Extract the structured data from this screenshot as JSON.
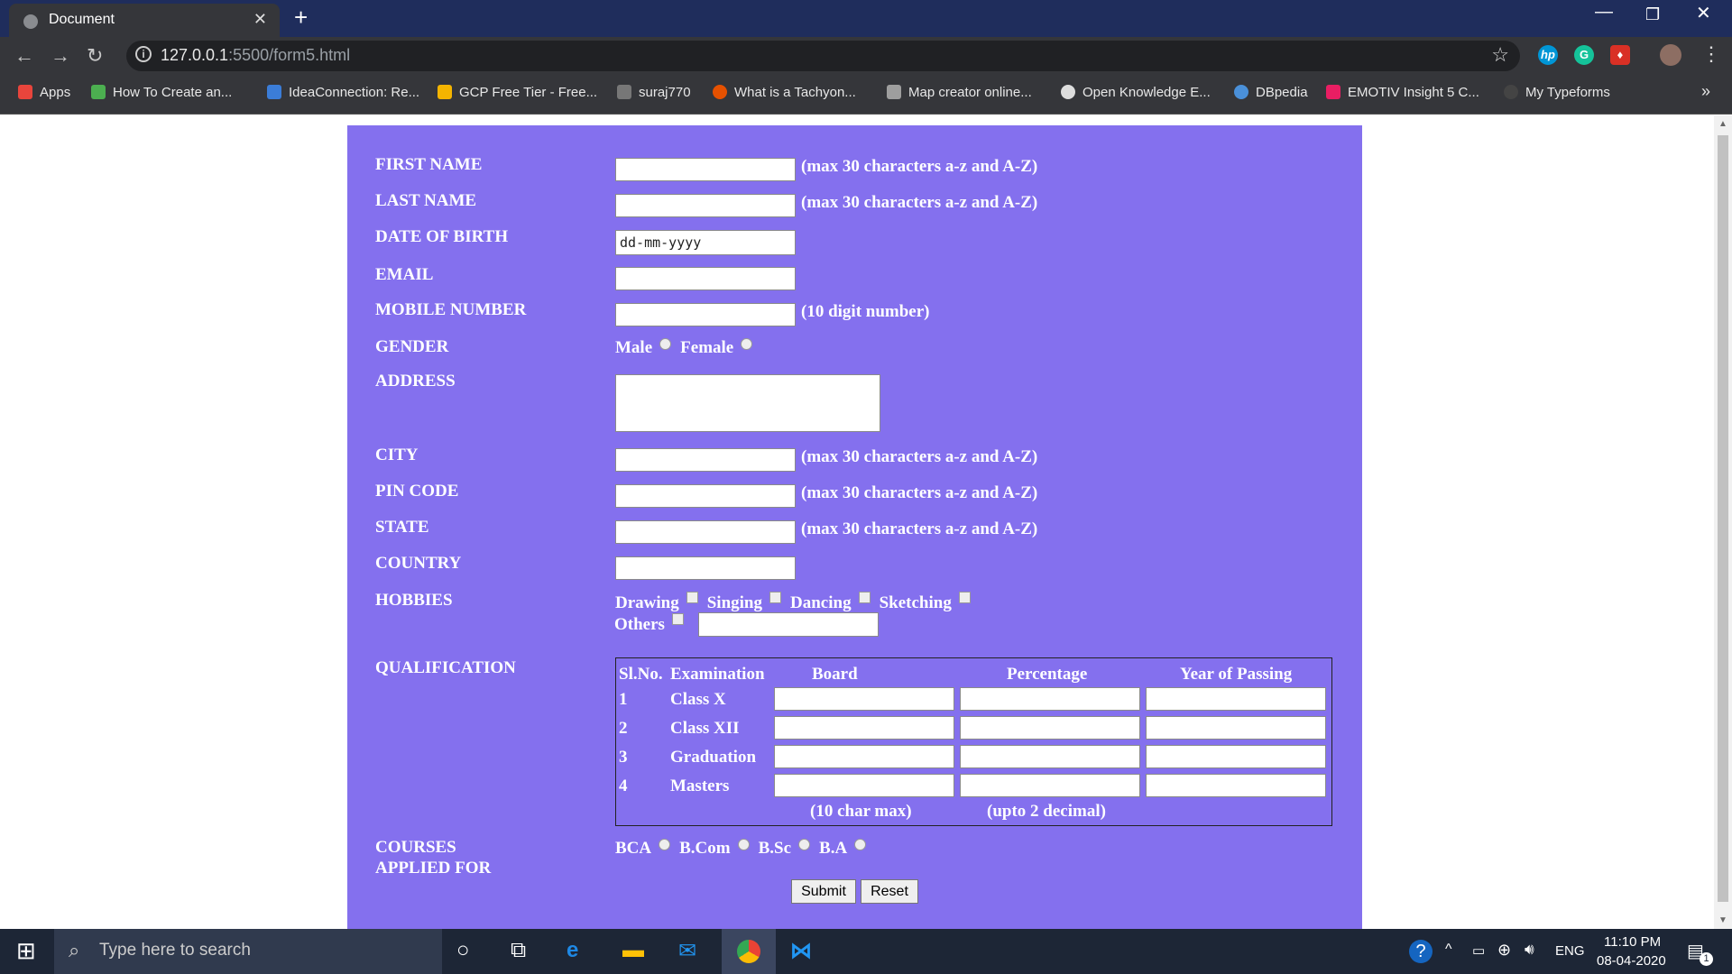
{
  "browser": {
    "tab_title": "Document",
    "tab_close": "✕",
    "new_tab": "+",
    "url_host": "127.0.0.1",
    "url_path": ":5500/form5.html",
    "bookmarks": [
      {
        "label": "Apps",
        "color": "#e8453c"
      },
      {
        "label": "How To Create an...",
        "color": "#4caf50"
      },
      {
        "label": "IdeaConnection: Re...",
        "color": "#3b7dd8"
      },
      {
        "label": "GCP Free Tier - Free...",
        "color": "#f4b400"
      },
      {
        "label": "suraj770",
        "color": "#777777"
      },
      {
        "label": "What is a Tachyon...",
        "color": "#e65100"
      },
      {
        "label": "Map creator online...",
        "color": "#9e9e9e"
      },
      {
        "label": "Open Knowledge E...",
        "color": "#dddddd"
      },
      {
        "label": "DBpedia",
        "color": "#4a90d9"
      },
      {
        "label": "EMOTIV Insight 5 C...",
        "color": "#e91e63"
      },
      {
        "label": "My Typeforms",
        "color": "#444444"
      }
    ],
    "more_bookmarks": "»"
  },
  "form": {
    "fields": {
      "first_name": {
        "label": "FIRST NAME",
        "hint": "(max 30 characters a-z and A-Z)"
      },
      "last_name": {
        "label": "LAST NAME",
        "hint": "(max 30 characters a-z and A-Z)"
      },
      "dob": {
        "label": "DATE OF BIRTH",
        "value": "dd-mm-yyyy"
      },
      "email": {
        "label": "EMAIL"
      },
      "mobile": {
        "label": "MOBILE NUMBER",
        "hint": "(10 digit number)"
      },
      "gender": {
        "label": "GENDER",
        "options": [
          "Male",
          "Female"
        ]
      },
      "address": {
        "label": "ADDRESS"
      },
      "city": {
        "label": "CITY",
        "hint": "(max 30 characters a-z and A-Z)"
      },
      "pin": {
        "label": "PIN CODE",
        "hint": "(max 30 characters a-z and A-Z)"
      },
      "state": {
        "label": "STATE",
        "hint": "(max 30 characters a-z and A-Z)"
      },
      "country": {
        "label": "COUNTRY"
      },
      "hobbies": {
        "label": "HOBBIES",
        "options": [
          "Drawing",
          "Singing",
          "Dancing",
          "Sketching",
          "Others"
        ]
      },
      "qualification": {
        "label": "QUALIFICATION"
      },
      "courses": {
        "label_line1": "COURSES",
        "label_line2": "APPLIED FOR",
        "options": [
          "BCA",
          "B.Com",
          "B.Sc",
          "B.A"
        ]
      }
    },
    "qual_table": {
      "headers": [
        "Sl.No.",
        "Examination",
        "Board",
        "Percentage",
        "Year of Passing"
      ],
      "rows": [
        {
          "num": "1",
          "exam": "Class X"
        },
        {
          "num": "2",
          "exam": "Class XII"
        },
        {
          "num": "3",
          "exam": "Graduation"
        },
        {
          "num": "4",
          "exam": "Masters"
        }
      ],
      "note_board": "(10 char max)",
      "note_percentage": "(upto 2 decimal)"
    },
    "submit_label": "Submit",
    "reset_label": "Reset"
  },
  "taskbar": {
    "search_placeholder": "Type here to search",
    "lang": "ENG",
    "time": "11:10 PM",
    "date": "08-04-2020",
    "notification_count": "1"
  }
}
